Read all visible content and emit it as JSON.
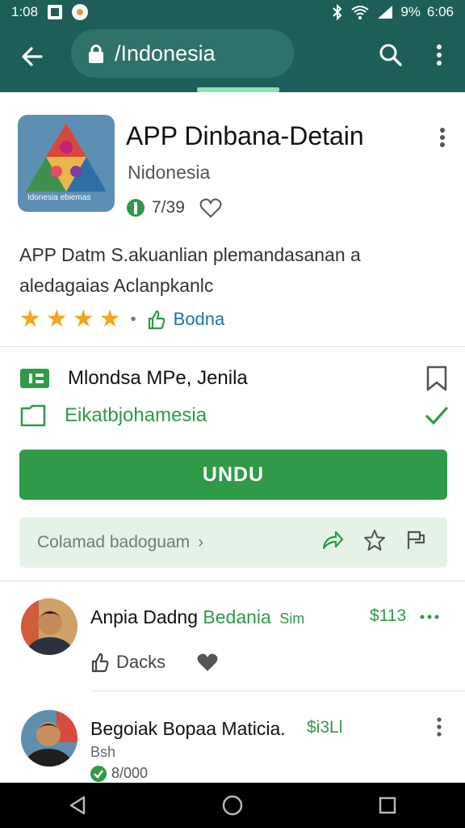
{
  "status_bar": {
    "time": "1:08",
    "battery": "9%",
    "clock": "6:06"
  },
  "app_bar": {
    "url": "/Indonesia"
  },
  "app": {
    "title": "APP Dinbana-Detain",
    "developer": "Nidonesia",
    "count": "7/39",
    "icon_text": "Idonesia ebiemas"
  },
  "description": "APP Datm S.akuanlian plemandasanan a aledagaias Aclanpkanlc",
  "rating": {
    "stars": 4,
    "label": "Bodna"
  },
  "info": {
    "row1": "Mlondsa MPe, Jenila",
    "row2": "Eikatbjohamesia"
  },
  "install_label": "UNDU",
  "secondary": {
    "label": "Colamad badoguam",
    "arrow": "›"
  },
  "reviews": [
    {
      "name": "Anpia Dadng",
      "highlight": "Bedania",
      "tag": "Sim",
      "price": "$113",
      "action_label": "Dacks"
    },
    {
      "name": "Begoiak Bopaa Maticia.",
      "price": "$i3Ll",
      "sub": "Bsh",
      "verified_count": "8/000"
    }
  ],
  "colors": {
    "primary": "#1e5e58",
    "accent": "#2f9a47",
    "star": "#f2a71b"
  }
}
